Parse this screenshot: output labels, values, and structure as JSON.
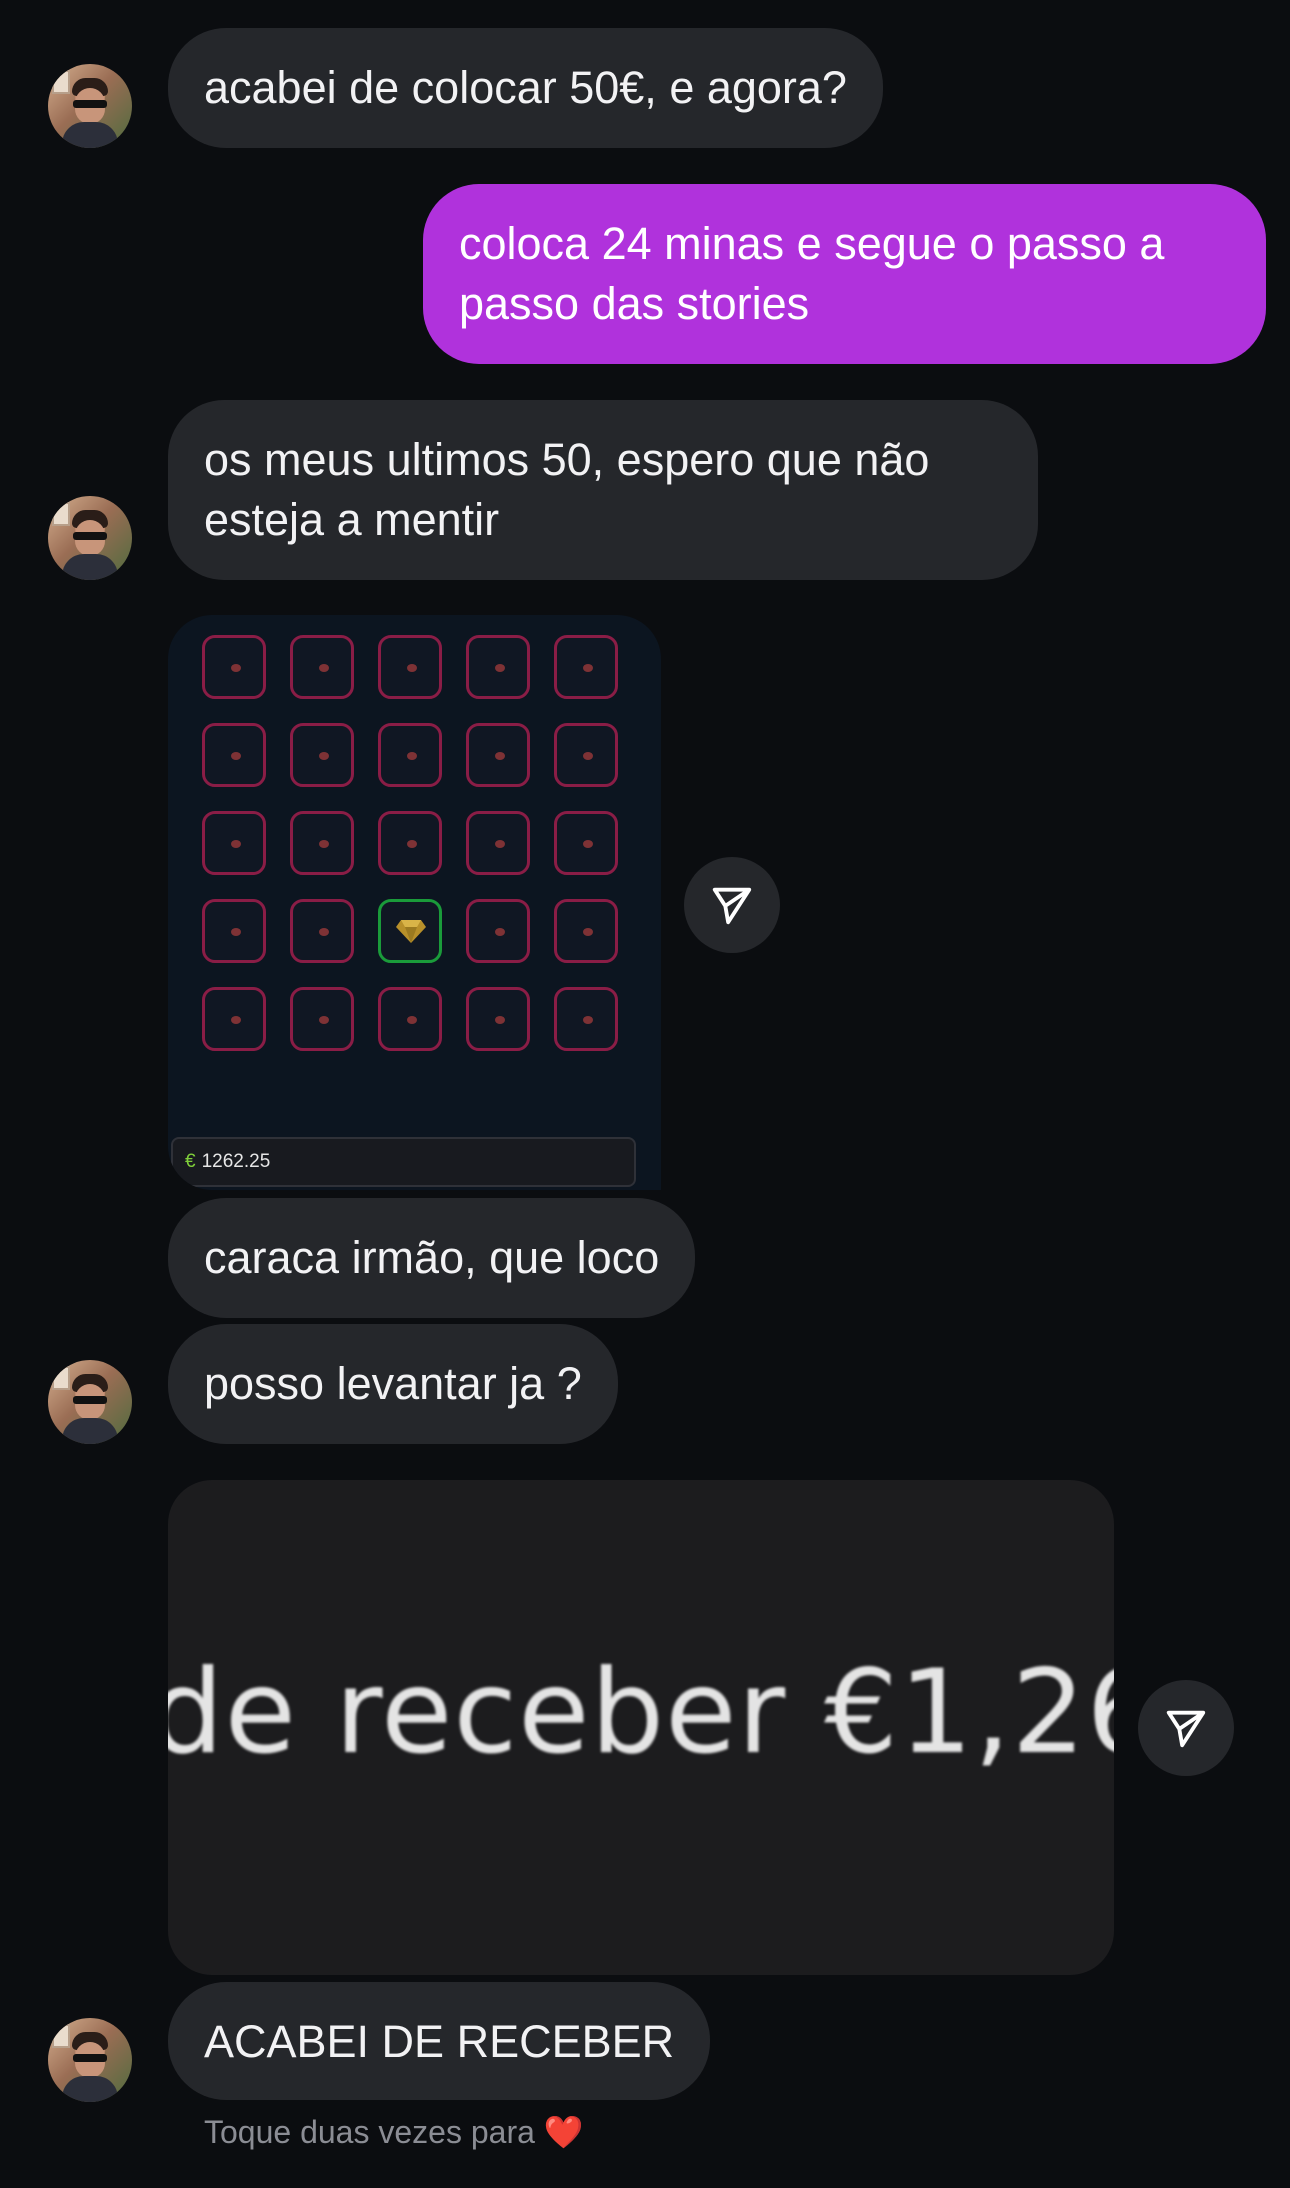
{
  "messages": {
    "m1": "acabei de colocar 50€, e agora?",
    "m2": "coloca 24 minas e segue o passo a passo das stories",
    "m3": "os meus ultimos 50, espero que não esteja a mentir",
    "m4": "caraca irmão, que loco",
    "m5": "posso levantar ja ?",
    "m6": "ACABEI DE RECEBER"
  },
  "game_screenshot": {
    "balance_currency": "€",
    "balance": "1262.25",
    "grid_rows": 5,
    "grid_cols": 5,
    "gem_tile": {
      "row": 4,
      "col": 3
    }
  },
  "photo_screenshot": {
    "text": "de receber €1,26"
  },
  "hint": {
    "text": "Toque duas vezes para",
    "emoji": "❤️"
  },
  "colors": {
    "incoming_bubble": "#25272b",
    "outgoing_bubble": "#b032dc",
    "background": "#0b0d10"
  },
  "icons": {
    "share": "paper-plane-icon",
    "avatar": "contact-avatar"
  }
}
